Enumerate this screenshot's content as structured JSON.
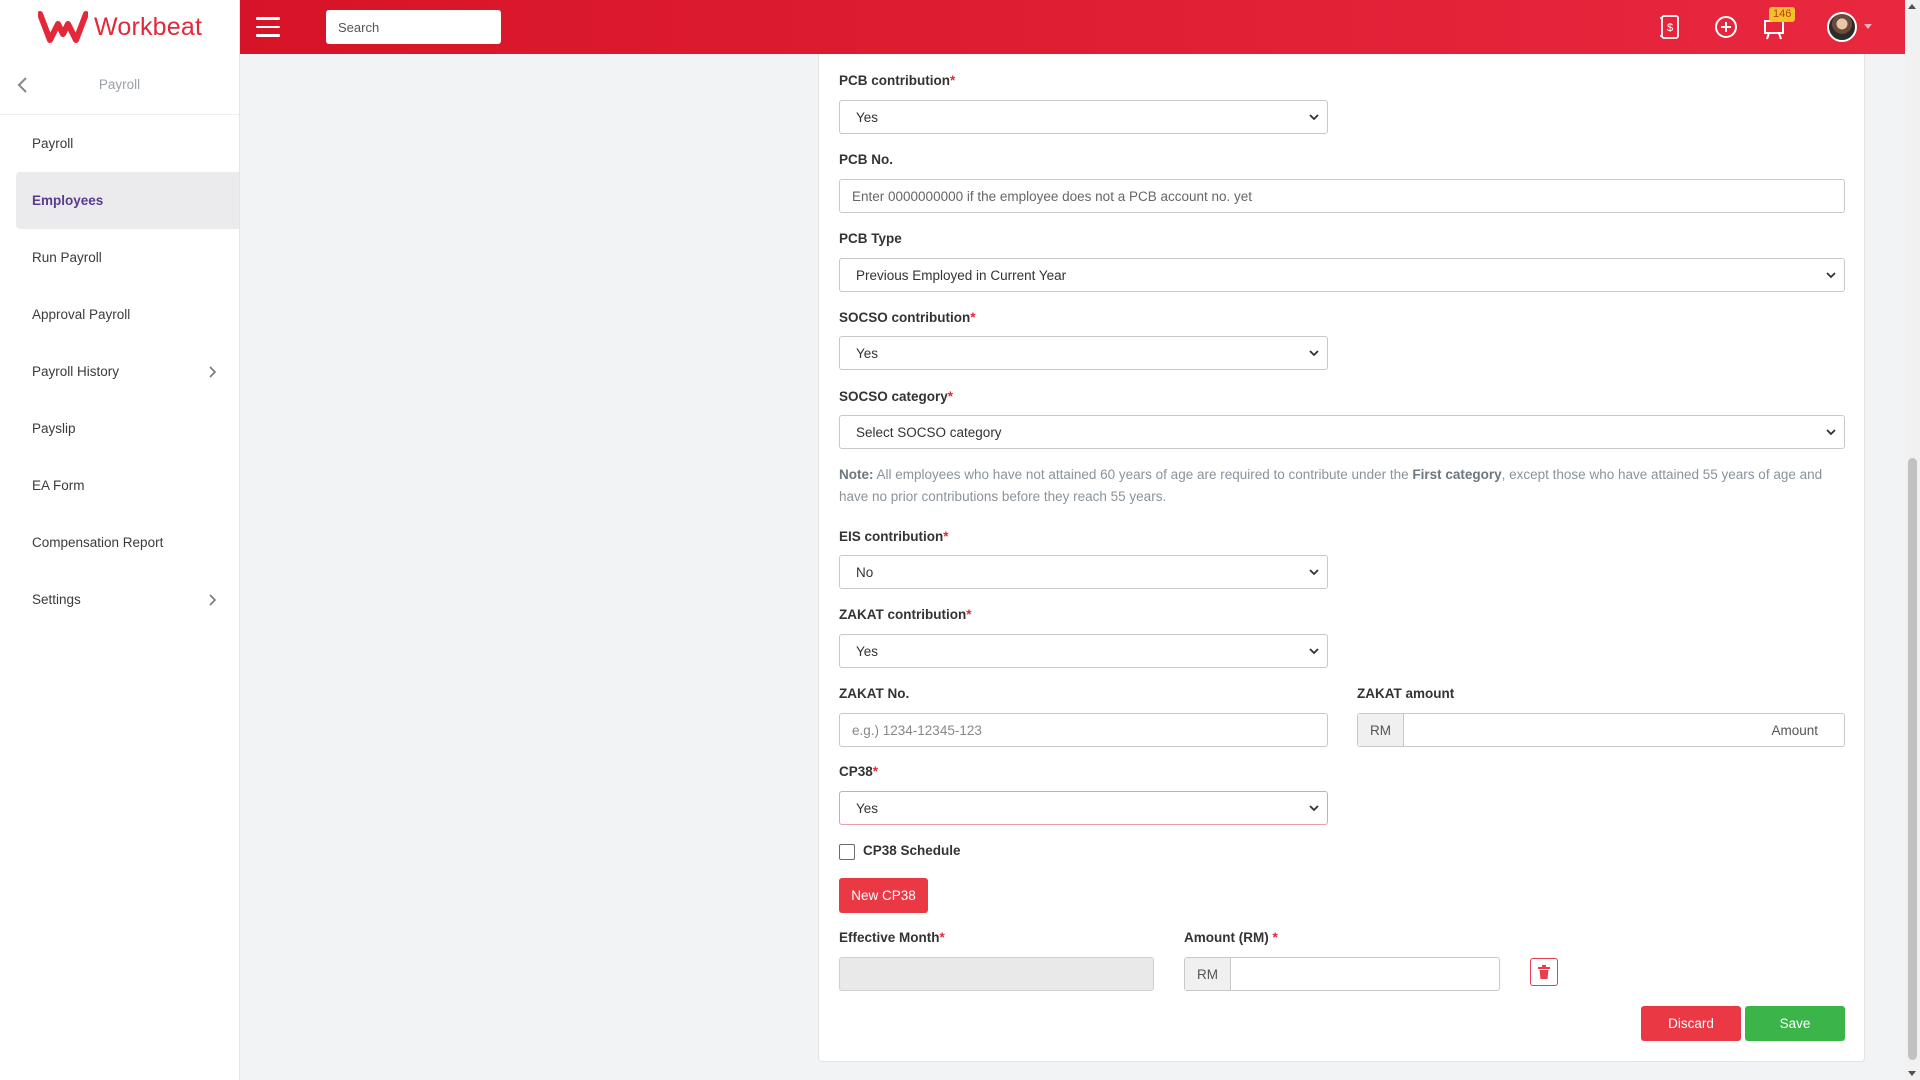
{
  "app": {
    "brand": "Workbeat"
  },
  "topbar": {
    "search_placeholder": "Search",
    "notification_count": "146"
  },
  "sidebar": {
    "section_title": "Payroll",
    "items": [
      {
        "label": "Payroll"
      },
      {
        "label": "Employees"
      },
      {
        "label": "Run Payroll"
      },
      {
        "label": "Approval Payroll"
      },
      {
        "label": "Payroll History"
      },
      {
        "label": "Payslip"
      },
      {
        "label": "EA Form"
      },
      {
        "label": "Compensation Report"
      },
      {
        "label": "Settings"
      }
    ]
  },
  "form": {
    "pcb_contribution": {
      "label": "PCB contribution",
      "required": "*",
      "value": "Yes"
    },
    "pcb_no": {
      "label": "PCB No.",
      "placeholder": "Enter 0000000000 if the employee does not  a PCB account no. yet"
    },
    "pcb_type": {
      "label": "PCB Type",
      "value": "Previous Employed in Current Year"
    },
    "socso_contribution": {
      "label": "SOCSO contribution",
      "required": "*",
      "value": "Yes"
    },
    "socso_category": {
      "label": "SOCSO category",
      "required": "*",
      "value": "Select SOCSO category"
    },
    "note": {
      "prefix": "Note:",
      "part1": " All employees who have not attained 60 years of age are required to contribute under the ",
      "emphasis": "First category",
      "part2": ", except those who have attained 55 years of age and have no prior contributions before they reach 55 years."
    },
    "eis_contribution": {
      "label": "EIS contribution",
      "required": "*",
      "value": "No"
    },
    "zakat_contribution": {
      "label": "ZAKAT contribution",
      "required": "*",
      "value": "Yes"
    },
    "zakat_no": {
      "label": "ZAKAT No.",
      "placeholder": "e.g.) 1234-12345-123"
    },
    "zakat_amount": {
      "label": "ZAKAT amount",
      "prefix": "RM",
      "placeholder": "Amount"
    },
    "cp38": {
      "label": "CP38",
      "required": "*",
      "value": "Yes"
    },
    "cp38_schedule": {
      "label": "CP38 Schedule",
      "checked": false
    },
    "new_cp38_button": "New CP38",
    "effective_month": {
      "label": "Effective Month",
      "required": "*"
    },
    "amount_rm": {
      "label": "Amount (RM) ",
      "required": "*",
      "prefix": "RM"
    },
    "discard_button": "Discard",
    "save_button": "Save"
  },
  "colors": {
    "brand_red": "#e3283a",
    "save_green": "#3bb54a",
    "badge_yellow": "#f5c02a"
  }
}
